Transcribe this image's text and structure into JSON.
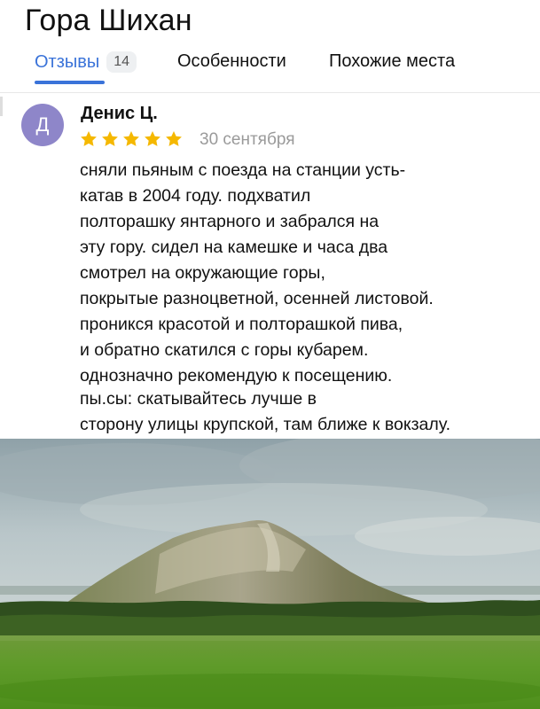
{
  "place": {
    "title": "Гора Шихан"
  },
  "tabs": [
    {
      "label": "Отзывы",
      "count": "14",
      "active": true
    },
    {
      "label": "Особенности"
    },
    {
      "label": "Похожие места"
    }
  ],
  "colors": {
    "accent": "#3a73d9",
    "star": "#f5b800",
    "avatar": "#8e86c9"
  },
  "review": {
    "avatar_letter": "Д",
    "author": "Денис Ц.",
    "rating": 5,
    "rating_max": 5,
    "date": "30 сентября",
    "text_lines": [
      "сняли пьяным с поезда на станции усть-",
      "катав в 2004 году. подхватил",
      "полторашку янтарного и забрался на",
      "эту гору. сидел на камешке и часа два",
      "смотрел на окружающие горы,",
      "покрытые разноцветной, осенней листовой.",
      "проникся красотой и полторашкой пива,",
      "и обратно скатился с горы кубарем.",
      "однозначно рекомендую к посещению."
    ],
    "ps_lines": [
      "пы.сы: скатывайтесь лучше в",
      "сторону улицы крупской, там ближе к вокзалу."
    ]
  },
  "photo": {
    "subject": "mountain-landscape"
  }
}
